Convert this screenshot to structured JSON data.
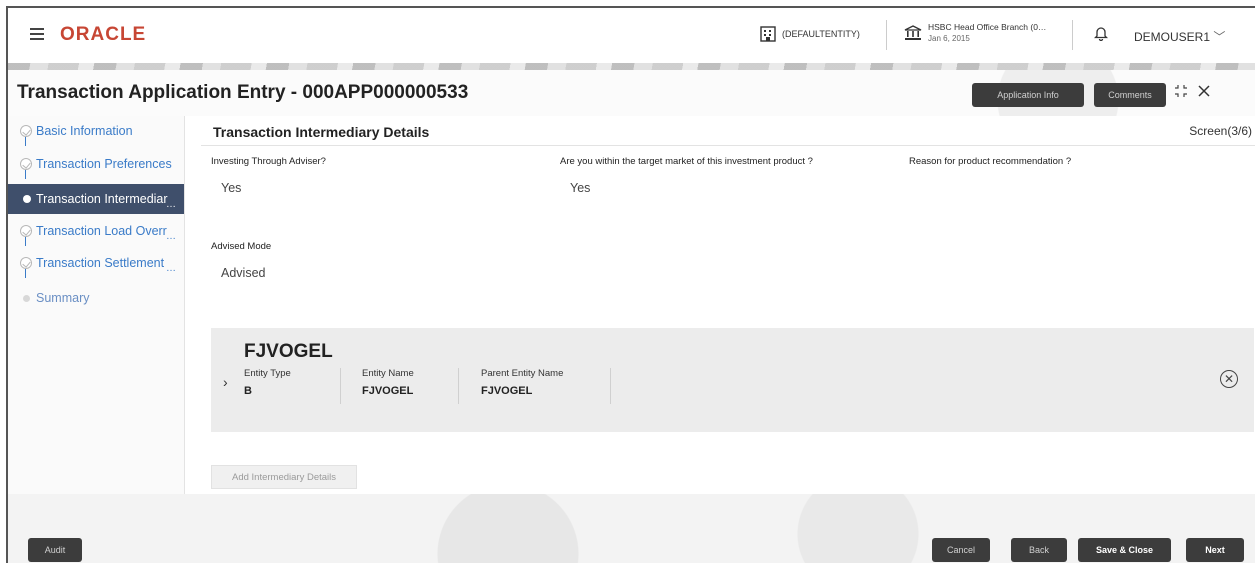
{
  "header": {
    "logo": "ORACLE",
    "entity": "(DEFAULTENTITY)",
    "branch_name": "HSBC Head Office Branch (0…",
    "branch_date": "Jan 6, 2015",
    "user": "DEMOUSER1"
  },
  "title": {
    "text": "Transaction Application Entry - 000APP000000533",
    "application_info_label": "Application Info",
    "comments_label": "Comments"
  },
  "sidebar": {
    "items": [
      {
        "label": "Basic Information",
        "state": "done"
      },
      {
        "label": "Transaction Preferences",
        "state": "done"
      },
      {
        "label": "Transaction Intermediar",
        "state": "active"
      },
      {
        "label": "Transaction Load Overr",
        "state": "done"
      },
      {
        "label": "Transaction Settlement",
        "state": "done"
      },
      {
        "label": "Summary",
        "state": "pending"
      }
    ]
  },
  "main": {
    "section_title": "Transaction Intermediary Details",
    "screen_indicator": "Screen(3/6)",
    "fields": {
      "investing_label": "Investing Through Adviser?",
      "investing_value": "Yes",
      "target_market_label": "Are you within the target market of this investment product ?",
      "target_market_value": "Yes",
      "reason_label": "Reason for product recommendation ?",
      "reason_value": "",
      "advised_mode_label": "Advised Mode",
      "advised_mode_value": "Advised"
    },
    "intermediary": {
      "name": "FJVOGEL",
      "entity_type_label": "Entity Type",
      "entity_type_value": "B",
      "entity_name_label": "Entity Name",
      "entity_name_value": "FJVOGEL",
      "parent_entity_label": "Parent Entity Name",
      "parent_entity_value": "FJVOGEL"
    },
    "add_button_label": "Add Intermediary Details"
  },
  "footer": {
    "audit_label": "Audit",
    "cancel_label": "Cancel",
    "back_label": "Back",
    "save_close_label": "Save & Close",
    "next_label": "Next"
  },
  "colors": {
    "oracle_red": "#c74634",
    "nav_link": "#3a7bc8",
    "nav_active_bg": "#3f4f6b",
    "button_dark": "#3c3c3c"
  }
}
